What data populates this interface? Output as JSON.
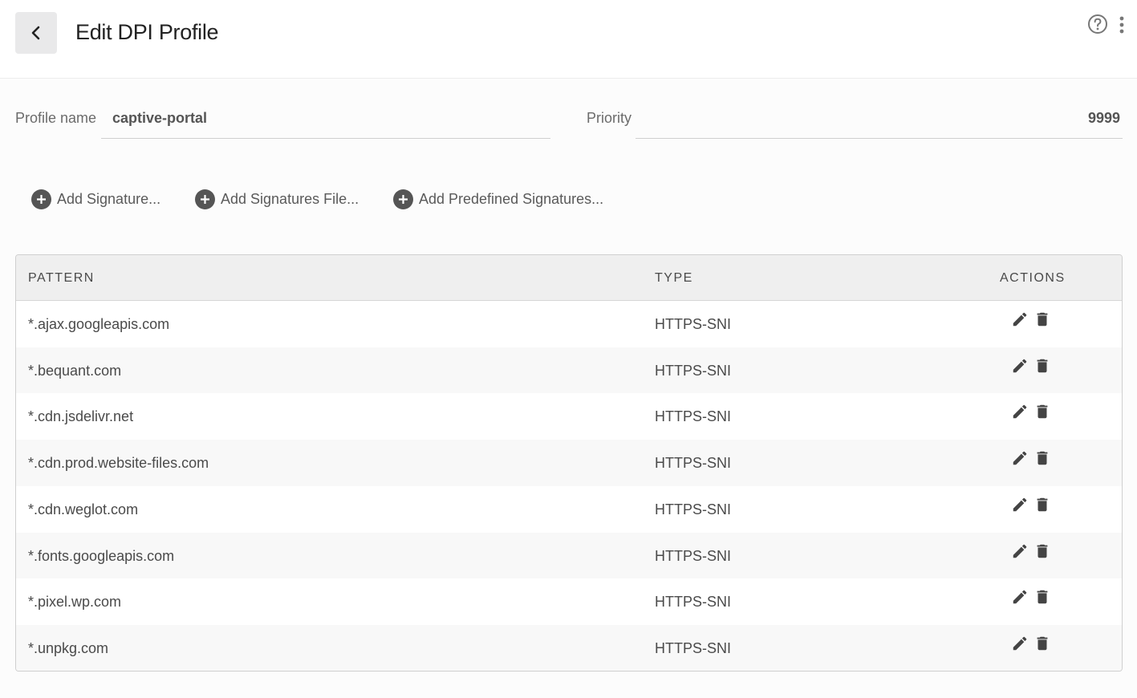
{
  "header": {
    "title": "Edit DPI Profile",
    "back_icon": "chevron-left-icon",
    "help_icon": "help-circle-icon",
    "menu_icon": "more-vertical-icon"
  },
  "form": {
    "profile_name_label": "Profile name",
    "profile_name_value": "captive-portal",
    "priority_label": "Priority",
    "priority_value": "9999"
  },
  "actions": {
    "add_signature": "Add Signature...",
    "add_signatures_file": "Add Signatures File...",
    "add_predefined": "Add Predefined Signatures..."
  },
  "table": {
    "columns": [
      "PATTERN",
      "TYPE",
      "ACTIONS"
    ],
    "rows": [
      {
        "pattern": "*.ajax.googleapis.com",
        "type": "HTTPS-SNI"
      },
      {
        "pattern": "*.bequant.com",
        "type": "HTTPS-SNI"
      },
      {
        "pattern": "*.cdn.jsdelivr.net",
        "type": "HTTPS-SNI"
      },
      {
        "pattern": "*.cdn.prod.website-files.com",
        "type": "HTTPS-SNI"
      },
      {
        "pattern": "*.cdn.weglot.com",
        "type": "HTTPS-SNI"
      },
      {
        "pattern": "*.fonts.googleapis.com",
        "type": "HTTPS-SNI"
      },
      {
        "pattern": "*.pixel.wp.com",
        "type": "HTTPS-SNI"
      },
      {
        "pattern": "*.unpkg.com",
        "type": "HTTPS-SNI"
      }
    ],
    "row_actions": [
      "edit-icon",
      "delete-icon"
    ]
  },
  "colors": {
    "icon": "#444444",
    "header_bg": "#efefef",
    "row_alt_bg": "#f8f8f8"
  }
}
